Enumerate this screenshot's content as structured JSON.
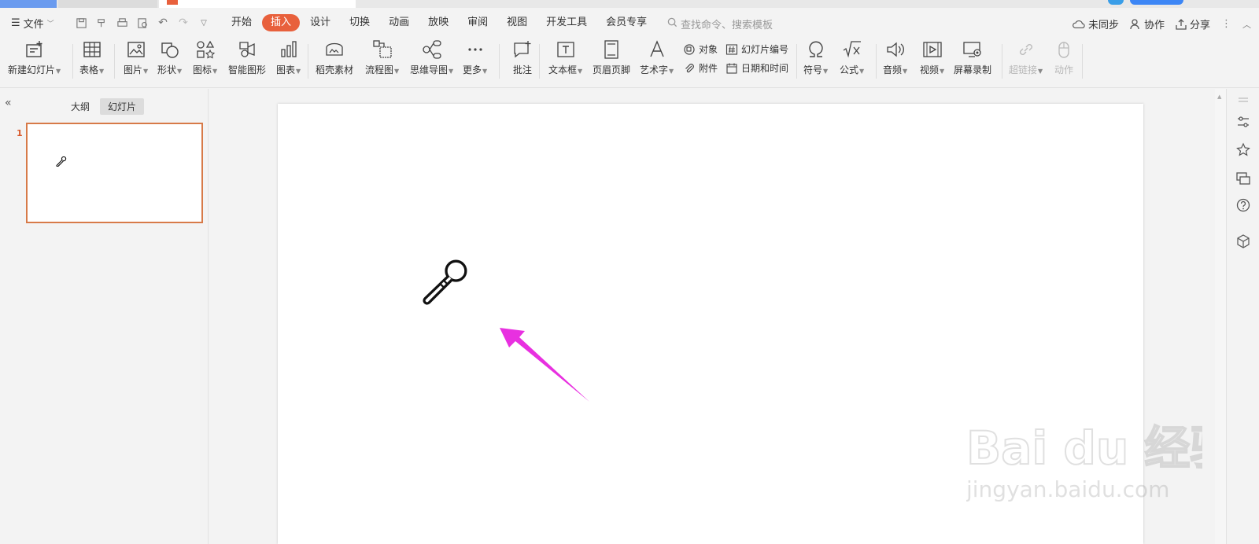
{
  "menu": {
    "file_label": "文件",
    "tabs": [
      {
        "label": "开始",
        "active": false
      },
      {
        "label": "插入",
        "active": true
      },
      {
        "label": "设计",
        "active": false
      },
      {
        "label": "切换",
        "active": false
      },
      {
        "label": "动画",
        "active": false
      },
      {
        "label": "放映",
        "active": false
      },
      {
        "label": "审阅",
        "active": false
      },
      {
        "label": "视图",
        "active": false
      },
      {
        "label": "开发工具",
        "active": false
      },
      {
        "label": "会员专享",
        "active": false
      }
    ],
    "search_placeholder": "查找命令、搜索模板",
    "sync_label": "未同步",
    "collab_label": "协作",
    "share_label": "分享"
  },
  "ribbon": {
    "new_slide": "新建幻灯片",
    "table": "表格",
    "picture": "图片",
    "shape": "形状",
    "icon": "图标",
    "smartart": "智能图形",
    "chart": "图表",
    "material": "稻壳素材",
    "flowchart": "流程图",
    "mindmap": "思维导图",
    "more": "更多",
    "comment": "批注",
    "textbox": "文本框",
    "header_footer": "页眉页脚",
    "wordart": "艺术字",
    "object": "对象",
    "slide_number": "幻灯片编号",
    "attachment": "附件",
    "datetime": "日期和时间",
    "symbol": "符号",
    "equation": "公式",
    "audio": "音频",
    "video": "视频",
    "screen_record": "屏幕录制",
    "hyperlink": "超链接",
    "action": "动作"
  },
  "left_panel": {
    "outline_tab": "大纲",
    "slides_tab": "幻灯片",
    "slide_number": "1"
  },
  "watermark": {
    "brand": "Bai du 经验",
    "url": "jingyan.baidu.com"
  },
  "colors": {
    "accent": "#e8603c",
    "arrow": "#e830e0",
    "thumb_border": "#d77a48"
  }
}
